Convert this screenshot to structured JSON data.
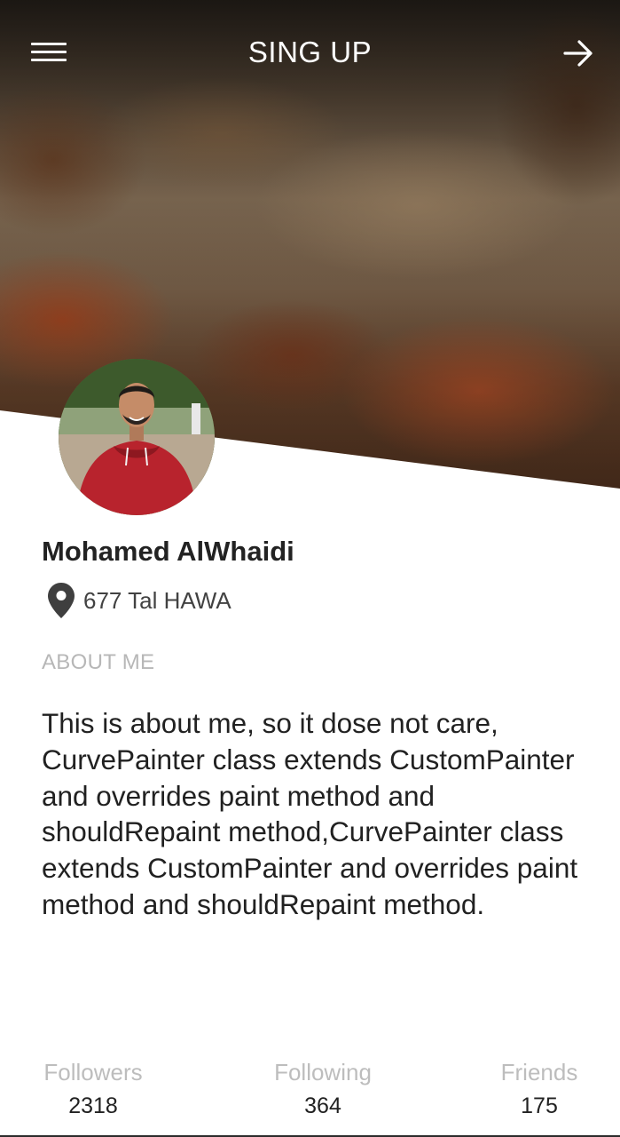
{
  "app_bar": {
    "title": "SING UP",
    "menu_icon": "menu-icon",
    "action_icon": "arrow-right-icon"
  },
  "profile": {
    "name": "Mohamed AlWhaidi",
    "location": "677 Tal HAWA",
    "location_icon": "location-pin-icon"
  },
  "about": {
    "label": "ABOUT ME",
    "text": "This is about me, so it dose not care, CurvePainter class extends CustomPainter and overrides paint method and shouldRepaint method,CurvePainter class extends CustomPainter and overrides paint method and shouldRepaint method."
  },
  "stats": [
    {
      "label": "Followers",
      "value": "2318"
    },
    {
      "label": "Following",
      "value": "364"
    },
    {
      "label": "Friends",
      "value": "175"
    }
  ],
  "colors": {
    "title": "#ffffff",
    "name": "#222222",
    "muted_label": "#b7b7b7",
    "body_text": "#212121"
  }
}
